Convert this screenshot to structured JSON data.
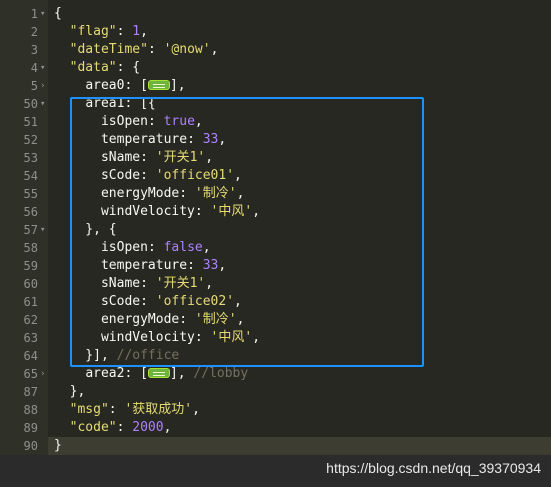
{
  "editor": {
    "lines": [
      {
        "num": "1",
        "fold": "▾",
        "tokens": [
          {
            "t": "p",
            "v": "{"
          }
        ]
      },
      {
        "num": "2",
        "fold": "",
        "tokens": [
          {
            "t": "p",
            "v": "  "
          },
          {
            "t": "k",
            "v": "\"flag\""
          },
          {
            "t": "p",
            "v": ": "
          },
          {
            "t": "n",
            "v": "1"
          },
          {
            "t": "p",
            "v": ","
          }
        ]
      },
      {
        "num": "3",
        "fold": "",
        "tokens": [
          {
            "t": "p",
            "v": "  "
          },
          {
            "t": "k",
            "v": "\"dateTime\""
          },
          {
            "t": "p",
            "v": ": "
          },
          {
            "t": "s",
            "v": "'@now'"
          },
          {
            "t": "p",
            "v": ","
          }
        ]
      },
      {
        "num": "4",
        "fold": "▾",
        "tokens": [
          {
            "t": "p",
            "v": "  "
          },
          {
            "t": "k",
            "v": "\"data\""
          },
          {
            "t": "p",
            "v": ": {"
          }
        ]
      },
      {
        "num": "5",
        "fold": "›",
        "tokens": [
          {
            "t": "p",
            "v": "    "
          },
          {
            "t": "id",
            "v": "area0"
          },
          {
            "t": "p",
            "v": ": ["
          },
          {
            "t": "fold",
            "v": ""
          },
          {
            "t": "p",
            "v": "],"
          }
        ]
      },
      {
        "num": "50",
        "fold": "▾",
        "tokens": [
          {
            "t": "p",
            "v": "    "
          },
          {
            "t": "id",
            "v": "area1"
          },
          {
            "t": "p",
            "v": ": [{"
          }
        ]
      },
      {
        "num": "51",
        "fold": "",
        "tokens": [
          {
            "t": "p",
            "v": "      "
          },
          {
            "t": "id",
            "v": "isOpen"
          },
          {
            "t": "p",
            "v": ": "
          },
          {
            "t": "b",
            "v": "true"
          },
          {
            "t": "p",
            "v": ","
          }
        ]
      },
      {
        "num": "52",
        "fold": "",
        "tokens": [
          {
            "t": "p",
            "v": "      "
          },
          {
            "t": "id",
            "v": "temperature"
          },
          {
            "t": "p",
            "v": ": "
          },
          {
            "t": "n",
            "v": "33"
          },
          {
            "t": "p",
            "v": ","
          }
        ]
      },
      {
        "num": "53",
        "fold": "",
        "tokens": [
          {
            "t": "p",
            "v": "      "
          },
          {
            "t": "id",
            "v": "sName"
          },
          {
            "t": "p",
            "v": ": "
          },
          {
            "t": "s",
            "v": "'开关1'"
          },
          {
            "t": "p",
            "v": ","
          }
        ]
      },
      {
        "num": "54",
        "fold": "",
        "tokens": [
          {
            "t": "p",
            "v": "      "
          },
          {
            "t": "id",
            "v": "sCode"
          },
          {
            "t": "p",
            "v": ": "
          },
          {
            "t": "s",
            "v": "'office01'"
          },
          {
            "t": "p",
            "v": ","
          }
        ]
      },
      {
        "num": "55",
        "fold": "",
        "tokens": [
          {
            "t": "p",
            "v": "      "
          },
          {
            "t": "id",
            "v": "energyMode"
          },
          {
            "t": "p",
            "v": ": "
          },
          {
            "t": "s",
            "v": "'制冷'"
          },
          {
            "t": "p",
            "v": ","
          }
        ]
      },
      {
        "num": "56",
        "fold": "",
        "tokens": [
          {
            "t": "p",
            "v": "      "
          },
          {
            "t": "id",
            "v": "windVelocity"
          },
          {
            "t": "p",
            "v": ": "
          },
          {
            "t": "s",
            "v": "'中风'"
          },
          {
            "t": "p",
            "v": ","
          }
        ]
      },
      {
        "num": "57",
        "fold": "▾",
        "tokens": [
          {
            "t": "p",
            "v": "    }, {"
          }
        ]
      },
      {
        "num": "58",
        "fold": "",
        "tokens": [
          {
            "t": "p",
            "v": "      "
          },
          {
            "t": "id",
            "v": "isOpen"
          },
          {
            "t": "p",
            "v": ": "
          },
          {
            "t": "b",
            "v": "false"
          },
          {
            "t": "p",
            "v": ","
          }
        ]
      },
      {
        "num": "59",
        "fold": "",
        "tokens": [
          {
            "t": "p",
            "v": "      "
          },
          {
            "t": "id",
            "v": "temperature"
          },
          {
            "t": "p",
            "v": ": "
          },
          {
            "t": "n",
            "v": "33"
          },
          {
            "t": "p",
            "v": ","
          }
        ]
      },
      {
        "num": "60",
        "fold": "",
        "tokens": [
          {
            "t": "p",
            "v": "      "
          },
          {
            "t": "id",
            "v": "sName"
          },
          {
            "t": "p",
            "v": ": "
          },
          {
            "t": "s",
            "v": "'开关1'"
          },
          {
            "t": "p",
            "v": ","
          }
        ]
      },
      {
        "num": "61",
        "fold": "",
        "tokens": [
          {
            "t": "p",
            "v": "      "
          },
          {
            "t": "id",
            "v": "sCode"
          },
          {
            "t": "p",
            "v": ": "
          },
          {
            "t": "s",
            "v": "'office02'"
          },
          {
            "t": "p",
            "v": ","
          }
        ]
      },
      {
        "num": "62",
        "fold": "",
        "tokens": [
          {
            "t": "p",
            "v": "      "
          },
          {
            "t": "id",
            "v": "energyMode"
          },
          {
            "t": "p",
            "v": ": "
          },
          {
            "t": "s",
            "v": "'制冷'"
          },
          {
            "t": "p",
            "v": ","
          }
        ]
      },
      {
        "num": "63",
        "fold": "",
        "tokens": [
          {
            "t": "p",
            "v": "      "
          },
          {
            "t": "id",
            "v": "windVelocity"
          },
          {
            "t": "p",
            "v": ": "
          },
          {
            "t": "s",
            "v": "'中风'"
          },
          {
            "t": "p",
            "v": ","
          }
        ]
      },
      {
        "num": "64",
        "fold": "",
        "tokens": [
          {
            "t": "p",
            "v": "    }], "
          },
          {
            "t": "c",
            "v": "//office"
          }
        ]
      },
      {
        "num": "65",
        "fold": "›",
        "tokens": [
          {
            "t": "p",
            "v": "    "
          },
          {
            "t": "id",
            "v": "area2"
          },
          {
            "t": "p",
            "v": ": ["
          },
          {
            "t": "fold",
            "v": ""
          },
          {
            "t": "p",
            "v": "], "
          },
          {
            "t": "c",
            "v": "//lobby"
          }
        ]
      },
      {
        "num": "87",
        "fold": "",
        "tokens": [
          {
            "t": "p",
            "v": "  },"
          }
        ]
      },
      {
        "num": "88",
        "fold": "",
        "tokens": [
          {
            "t": "p",
            "v": "  "
          },
          {
            "t": "k",
            "v": "\"msg\""
          },
          {
            "t": "p",
            "v": ": "
          },
          {
            "t": "s",
            "v": "'获取成功'"
          },
          {
            "t": "p",
            "v": ","
          }
        ]
      },
      {
        "num": "89",
        "fold": "",
        "tokens": [
          {
            "t": "p",
            "v": "  "
          },
          {
            "t": "k",
            "v": "\"code\""
          },
          {
            "t": "p",
            "v": ": "
          },
          {
            "t": "n",
            "v": "2000"
          },
          {
            "t": "p",
            "v": ","
          }
        ]
      },
      {
        "num": "90",
        "fold": "",
        "tokens": [
          {
            "t": "p",
            "v": "}"
          }
        ]
      }
    ],
    "active_line_index": 24,
    "colors": {
      "background": "#272822",
      "gutter": "#2f3129",
      "string": "#e6db74",
      "number": "#ae81ff",
      "comment": "#75715e",
      "highlight_box": "#1e90ff",
      "fold_widget": "#6fb43f"
    }
  },
  "watermark": {
    "text": "https://blog.csdn.net/qq_39370934"
  }
}
